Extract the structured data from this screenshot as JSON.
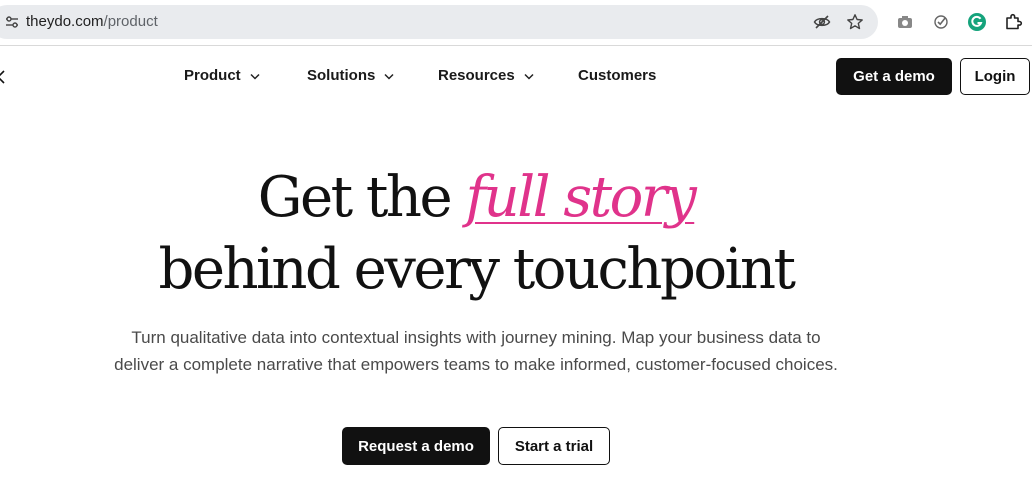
{
  "browser": {
    "url_domain": "theydo.com",
    "url_path": "/product",
    "icons": [
      "tune-icon",
      "eye-off-icon",
      "star-icon",
      "camera-icon",
      "checkmark-circle-icon",
      "grammarly-icon",
      "extensions-icon"
    ]
  },
  "nav": {
    "items": [
      {
        "label": "Product",
        "has_dropdown": true
      },
      {
        "label": "Solutions",
        "has_dropdown": true
      },
      {
        "label": "Resources",
        "has_dropdown": true
      },
      {
        "label": "Customers",
        "has_dropdown": false
      }
    ],
    "demo_label": "Get a demo",
    "login_label": "Login"
  },
  "hero": {
    "line1_prefix": "Get the ",
    "line1_accent": "full story",
    "line2": "behind every touchpoint",
    "subtext": "Turn qualitative data into contextual insights with journey mining.  Map your business data to deliver a complete narrative that empowers teams to make informed, customer-focused choices.",
    "cta_primary": "Request a demo",
    "cta_secondary": "Start a trial"
  },
  "colors": {
    "accent": "#e0338b",
    "primary_button": "#111111",
    "omnibox": "#e9ebee"
  }
}
